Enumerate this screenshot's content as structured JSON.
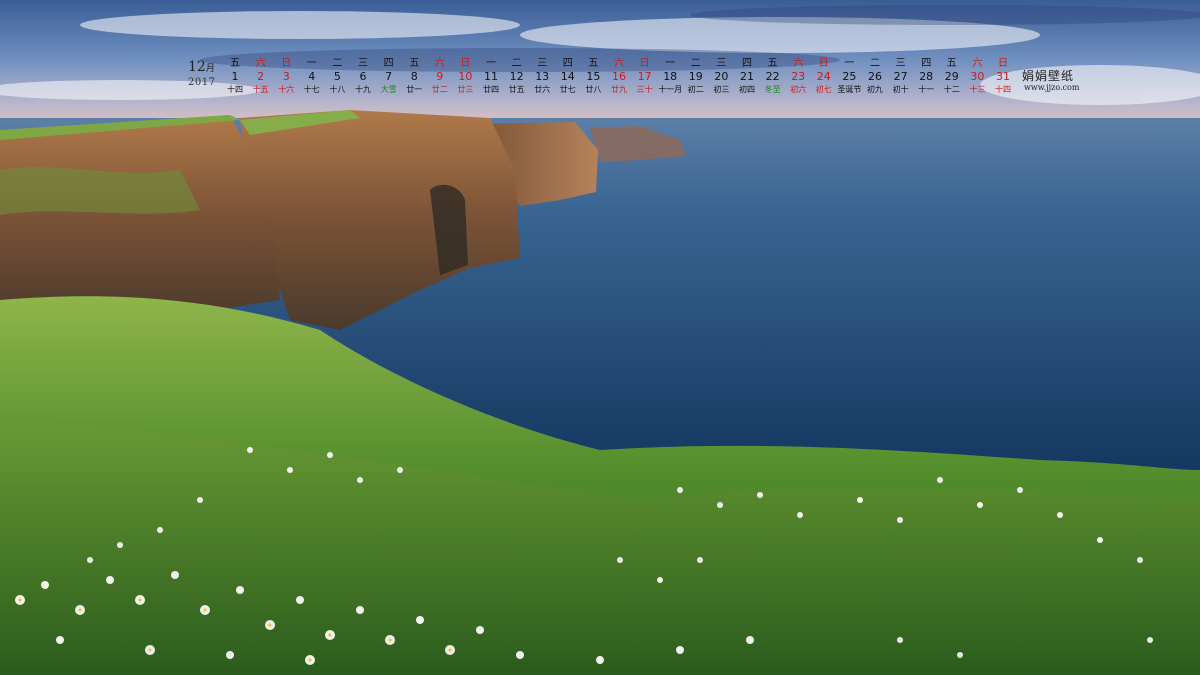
{
  "calendar": {
    "month_number": "12",
    "month_suffix": "月",
    "year": "2017",
    "days": [
      {
        "wd": "五",
        "d": "1",
        "lunar": "十四",
        "weekend": false
      },
      {
        "wd": "六",
        "d": "2",
        "lunar": "十五",
        "weekend": true
      },
      {
        "wd": "日",
        "d": "3",
        "lunar": "十六",
        "weekend": true
      },
      {
        "wd": "一",
        "d": "4",
        "lunar": "十七",
        "weekend": false
      },
      {
        "wd": "二",
        "d": "5",
        "lunar": "十八",
        "weekend": false
      },
      {
        "wd": "三",
        "d": "6",
        "lunar": "十九",
        "weekend": false
      },
      {
        "wd": "四",
        "d": "7",
        "lunar": "大雪",
        "weekend": false,
        "term": true
      },
      {
        "wd": "五",
        "d": "8",
        "lunar": "廿一",
        "weekend": false
      },
      {
        "wd": "六",
        "d": "9",
        "lunar": "廿二",
        "weekend": true
      },
      {
        "wd": "日",
        "d": "10",
        "lunar": "廿三",
        "weekend": true
      },
      {
        "wd": "一",
        "d": "11",
        "lunar": "廿四",
        "weekend": false
      },
      {
        "wd": "二",
        "d": "12",
        "lunar": "廿五",
        "weekend": false
      },
      {
        "wd": "三",
        "d": "13",
        "lunar": "廿六",
        "weekend": false
      },
      {
        "wd": "四",
        "d": "14",
        "lunar": "廿七",
        "weekend": false
      },
      {
        "wd": "五",
        "d": "15",
        "lunar": "廿八",
        "weekend": false
      },
      {
        "wd": "六",
        "d": "16",
        "lunar": "廿九",
        "weekend": true
      },
      {
        "wd": "日",
        "d": "17",
        "lunar": "三十",
        "weekend": true
      },
      {
        "wd": "一",
        "d": "18",
        "lunar": "十一月",
        "weekend": false
      },
      {
        "wd": "二",
        "d": "19",
        "lunar": "初二",
        "weekend": false
      },
      {
        "wd": "三",
        "d": "20",
        "lunar": "初三",
        "weekend": false
      },
      {
        "wd": "四",
        "d": "21",
        "lunar": "初四",
        "weekend": false
      },
      {
        "wd": "五",
        "d": "22",
        "lunar": "冬至",
        "weekend": false,
        "term": true
      },
      {
        "wd": "六",
        "d": "23",
        "lunar": "初六",
        "weekend": true
      },
      {
        "wd": "日",
        "d": "24",
        "lunar": "初七",
        "weekend": true
      },
      {
        "wd": "一",
        "d": "25",
        "lunar": "圣诞节",
        "weekend": false
      },
      {
        "wd": "二",
        "d": "26",
        "lunar": "初九",
        "weekend": false
      },
      {
        "wd": "三",
        "d": "27",
        "lunar": "初十",
        "weekend": false
      },
      {
        "wd": "四",
        "d": "28",
        "lunar": "十一",
        "weekend": false
      },
      {
        "wd": "五",
        "d": "29",
        "lunar": "十二",
        "weekend": false
      },
      {
        "wd": "六",
        "d": "30",
        "lunar": "十三",
        "weekend": true
      },
      {
        "wd": "日",
        "d": "31",
        "lunar": "十四",
        "weekend": true
      }
    ]
  },
  "brand": {
    "name": "娟娟壁纸",
    "url": "www.jjzo.com"
  },
  "colors": {
    "sky_top": "#3c5f97",
    "sky_bottom": "#e9c6c0",
    "sea": "#1f4d7f",
    "cliff": "#8a5a3a",
    "grass": "#5e8f2e",
    "weekend_red": "#d01818",
    "term_green": "#1a8a1a"
  }
}
